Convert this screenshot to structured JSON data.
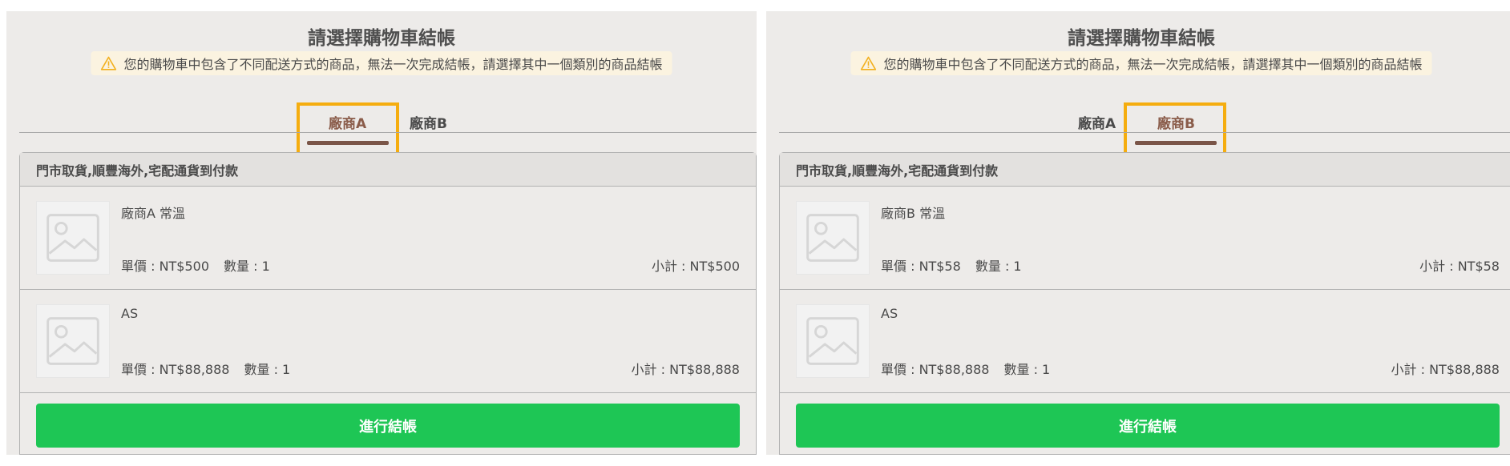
{
  "panels": [
    {
      "title": "請選擇購物車結帳",
      "warning": "您的購物車中包含了不同配送方式的商品，無法一次完成結帳，請選擇其中一個類別的商品結帳",
      "tabs": [
        {
          "label": "廠商A",
          "active": true
        },
        {
          "label": "廠商B",
          "active": false
        }
      ],
      "section_title": "門市取貨,順豐海外,宅配通貨到付款",
      "items": [
        {
          "name": "廠商A 常溫",
          "price": "單價 : NT$500",
          "qty": "數量 : 1",
          "subtotal": "小計 : NT$500"
        },
        {
          "name": "AS",
          "price": "單價 : NT$88,888",
          "qty": "數量 : 1",
          "subtotal": "小計 : NT$88,888"
        }
      ],
      "checkout_label": "進行結帳"
    },
    {
      "title": "請選擇購物車結帳",
      "warning": "您的購物車中包含了不同配送方式的商品，無法一次完成結帳，請選擇其中一個類別的商品結帳",
      "tabs": [
        {
          "label": "廠商A",
          "active": false
        },
        {
          "label": "廠商B",
          "active": true
        }
      ],
      "section_title": "門市取貨,順豐海外,宅配通貨到付款",
      "items": [
        {
          "name": "廠商B 常溫",
          "price": "單價 : NT$58",
          "qty": "數量 : 1",
          "subtotal": "小計 : NT$58"
        },
        {
          "name": "AS",
          "price": "單價 : NT$88,888",
          "qty": "數量 : 1",
          "subtotal": "小計 : NT$88,888"
        }
      ],
      "checkout_label": "進行結帳"
    }
  ],
  "colors": {
    "accent_green": "#1ec655",
    "tab_active": "#8a5c4a",
    "tab_underline": "#7a5548",
    "highlight": "#f5ad0f",
    "warning_bg": "#fbf3e0",
    "warning_icon": "#f2b01e"
  },
  "icons": {
    "warning": "warning-triangle-icon",
    "thumbnail": "image-placeholder-icon"
  }
}
